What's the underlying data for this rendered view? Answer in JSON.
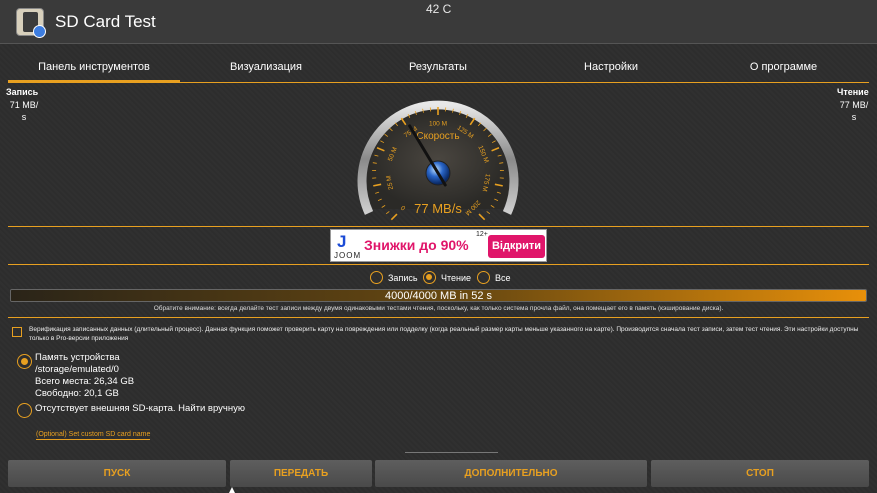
{
  "app": {
    "title": "SD Card Test",
    "temperature": "42 C"
  },
  "tabs": [
    {
      "label": "Панель инструментов"
    },
    {
      "label": "Визуализация"
    },
    {
      "label": "Результаты"
    },
    {
      "label": "Настройки"
    },
    {
      "label": "О программе"
    }
  ],
  "write": {
    "label": "Запись",
    "value_line1": "71 MB/",
    "value_line2": "s"
  },
  "read": {
    "label": "Чтение",
    "value_line1": "77 MB/",
    "value_line2": "s"
  },
  "gauge": {
    "title": "Скорость",
    "value": "77 MB/s",
    "ticks": [
      "0",
      "25 M",
      "50 M",
      "75 M",
      "100 M",
      "125 M",
      "150 M",
      "175 M",
      "200 M"
    ],
    "needle_value": 77,
    "max": 200
  },
  "ad": {
    "logo_letter": "J",
    "brand": "JOOM",
    "text": "Знижки до 90%",
    "superscript": "12+",
    "button": "Відкрити"
  },
  "mode": {
    "options": [
      "Запись",
      "Чтение",
      "Все"
    ],
    "selected": "Чтение"
  },
  "progress": {
    "text": "4000/4000 MB in 52 s",
    "fraction": 1.0
  },
  "note": "Обратите внимание: всегда делайте тест записи между двумя одинаковыми тестами чтения, поскольку, как только система прочла файл, она помещает его в память (кэширование диска).",
  "verification": {
    "checked": false,
    "text": "Верификация записанных данных (длительный процесс). Данная функция поможет проверить карту на повреждения или подделку (когда реальный размер карты меньше указанного на карте). Производится сначала тест записи, затем тест чтения. Эти настройки доступны только в Pro-версии приложения"
  },
  "storage": {
    "name": "Память устройства",
    "path": "/storage/emulated/0",
    "total": "Всего места: 26,34 GB",
    "free": "Свободно: 20,1 GB",
    "selected": true
  },
  "external": {
    "text": "Отсутствует внешняя SD-карта. Найти вручную",
    "selected": false
  },
  "custom_name": "(Optional) Set custom SD card name",
  "buttons": {
    "start": "ПУСК",
    "send": "ПЕРЕДАТЬ",
    "more": "ДОПОЛНИТЕЛЬНО",
    "stop": "СТОП"
  },
  "colors": {
    "accent": "#e8a020",
    "background": "#2e2e2e"
  }
}
